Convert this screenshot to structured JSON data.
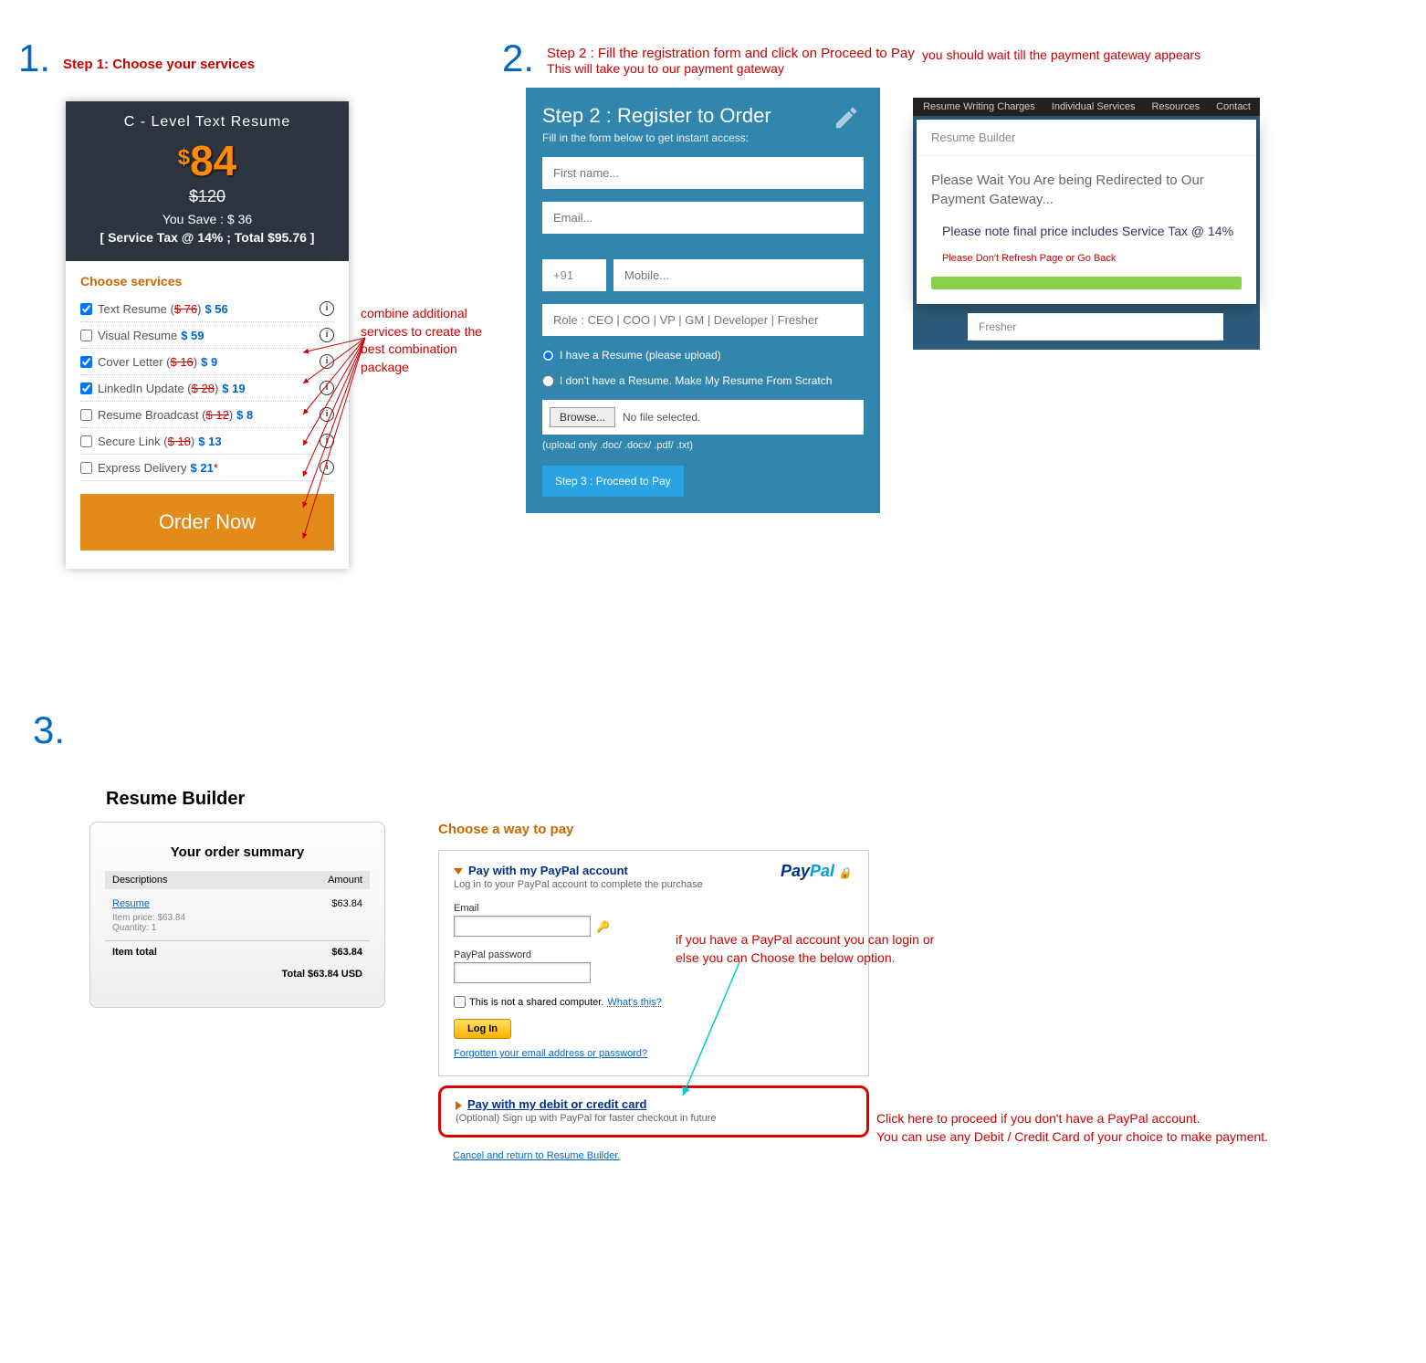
{
  "step1": {
    "num": "1.",
    "label": "Step 1: Choose your services",
    "card_title": "C - Level Text Resume",
    "price": "84",
    "currency": "$",
    "old_price": "$120",
    "save": "You Save : $ 36",
    "tax": "[ Service Tax @ 14% ; Total $95.76 ]",
    "choose_title": "Choose services",
    "services": [
      {
        "checked": true,
        "label": "Text Resume ( ",
        "strike": "$ 76",
        "after": " ) ",
        "price": "$ 56"
      },
      {
        "checked": false,
        "label": "Visual Resume ",
        "strike": "",
        "after": "",
        "price": "$ 59"
      },
      {
        "checked": true,
        "label": "Cover Letter ( ",
        "strike": "$ 16",
        "after": " ) ",
        "price": "$ 9"
      },
      {
        "checked": true,
        "label": "LinkedIn Update ( ",
        "strike": "$ 28",
        "after": " ) ",
        "price": "$ 19"
      },
      {
        "checked": false,
        "label": "Resume Broadcast ( ",
        "strike": "$ 12",
        "after": ")",
        "price": "$ 8"
      },
      {
        "checked": false,
        "label": "Secure Link ( ",
        "strike": "$ 18",
        "after": " ) ",
        "price": "$ 13"
      },
      {
        "checked": false,
        "label": "Express Delivery ",
        "strike": "",
        "after": "",
        "price": "$ 21",
        "star": "*"
      }
    ],
    "order_btn": "Order Now",
    "combine_note": "combine additional services to create the best combination package"
  },
  "step2": {
    "num": "2.",
    "label_line1": "Step 2 : Fill the registration form and click on Proceed to Pay",
    "label_line2": "This will take you to our payment gateway",
    "title": "Step 2 : Register to Order",
    "sub": "Fill in the form below to get instant access:",
    "ph_first": "First name...",
    "ph_email": "Email...",
    "ph_cc": "+91",
    "ph_mobile": "Mobile...",
    "ph_role": "Role : CEO | COO | VP | GM | Developer | Fresher",
    "radio1": "I have a Resume (please upload)",
    "radio2": "I don't have a Resume. Make My Resume From Scratch",
    "browse": "Browse...",
    "nofile": "No file selected.",
    "upload_note": "(upload only .doc/ .docx/ .pdf/ .txt)",
    "proceed": "Step 3 : Proceed to Pay"
  },
  "step2b": {
    "wait_label": "you should wait till the payment gateway appears",
    "nav": [
      "Resume Writing Charges",
      "Individual Services",
      "Resources",
      "Contact"
    ],
    "modal_title": "Resume Builder",
    "wait": "Please Wait You Are being Redirected to Our Payment Gateway...",
    "note": "Please note final price includes Service Tax @ 14%",
    "warn": "Please Don't Refresh Page or Go Back",
    "fresher": "Fresher"
  },
  "step3": {
    "num": "3.",
    "title": "Resume Builder",
    "summary_title": "Your order summary",
    "col1": "Descriptions",
    "col2": "Amount",
    "item_name": "Resume",
    "item_amount": "$63.84",
    "item_price": "Item price: $63.84",
    "item_qty": "Quantity: 1",
    "item_total_label": "Item total",
    "item_total": "$63.84",
    "grand_total": "Total $63.84 USD",
    "choose_pay": "Choose a way to pay",
    "pp_head": "Pay with my PayPal account",
    "pp_sub": "Log in to your PayPal account to complete the purchase",
    "pp_brand1": "Pay",
    "pp_brand2": "Pal",
    "email_label": "Email",
    "pwd_label": "PayPal password",
    "shared": "This is not a shared computer.",
    "whats": "What's this?",
    "login": "Log In",
    "forgot": "Forgotten your email address or password?",
    "cc_head": "Pay with my debit or credit card",
    "cc_sub": "(Optional) Sign up with PayPal for faster checkout in future",
    "cancel": "Cancel and return to Resume Builder.",
    "note_login": "if you have a PayPal account you can login or else you can Choose the below option.",
    "note_cc1": "Click here to proceed if you don't have a PayPal account.",
    "note_cc2": "You can use any Debit / Credit Card of your choice to make payment."
  }
}
